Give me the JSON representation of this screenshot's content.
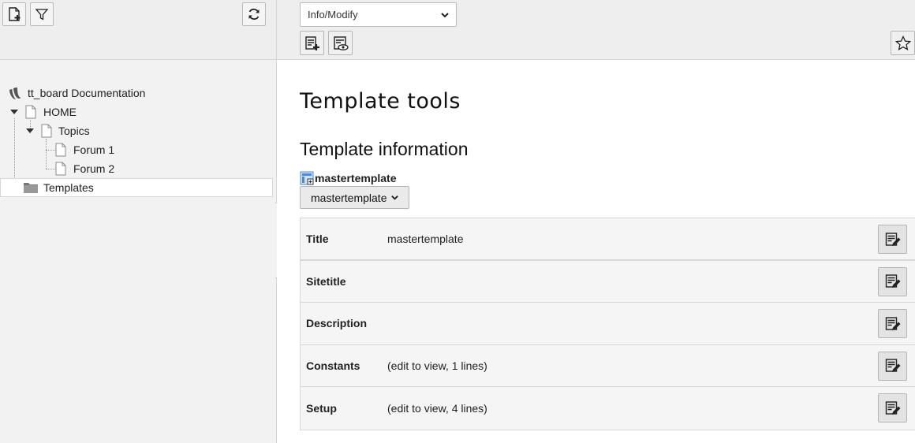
{
  "tree": {
    "root": "tt_board Documentation",
    "items": [
      {
        "label": "HOME"
      },
      {
        "label": "Topics"
      },
      {
        "label": "Forum 1"
      },
      {
        "label": "Forum 2"
      },
      {
        "label": "Templates"
      }
    ]
  },
  "toolbar": {
    "module_select": "Info/Modify"
  },
  "main": {
    "title": "Template tools",
    "subtitle": "Template information",
    "template_name": "mastertemplate",
    "template_dropdown": "mastertemplate",
    "rows": [
      {
        "label": "Title",
        "value": "mastertemplate"
      },
      {
        "label": "Sitetitle",
        "value": ""
      },
      {
        "label": "Description",
        "value": ""
      },
      {
        "label": "Constants",
        "value": "(edit to view, 1 lines)"
      },
      {
        "label": "Setup",
        "value": "(edit to view, 4 lines)"
      }
    ]
  },
  "colors": {
    "panel_bg": "#f2f2f2",
    "toolbar_bg": "#eeeeee",
    "border": "#d7d7d7"
  },
  "icons": [
    "new-page-icon",
    "filter-icon",
    "refresh-icon",
    "typo3-logo-icon",
    "page-icon",
    "folder-icon",
    "new-record-icon",
    "view-record-icon",
    "bookmark-star-icon",
    "template-icon",
    "edit-record-icon"
  ]
}
